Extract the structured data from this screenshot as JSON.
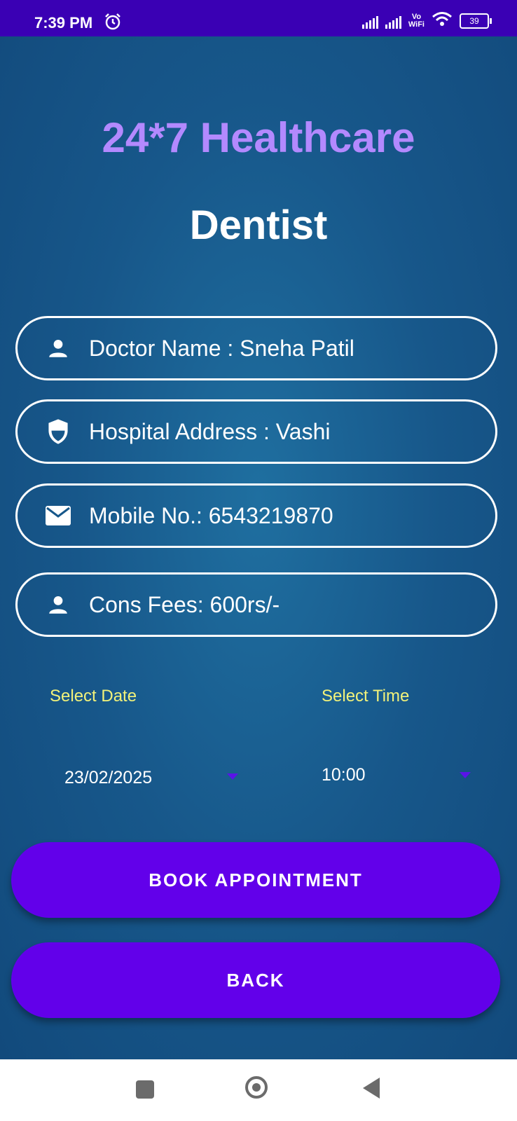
{
  "status_bar": {
    "time": "7:39 PM",
    "vowifi_top": "Vo",
    "vowifi_bottom": "WiFi",
    "battery": "39"
  },
  "header": {
    "app_title": "24*7 Healthcare",
    "page_title": "Dentist"
  },
  "fields": [
    {
      "icon": "person-icon",
      "text": "Doctor Name : Sneha Patil"
    },
    {
      "icon": "shield-icon",
      "text": "Hospital Address : Vashi"
    },
    {
      "icon": "mail-icon",
      "text": "Mobile No.: 6543219870"
    },
    {
      "icon": "person-icon",
      "text": "Cons Fees: 600rs/-"
    }
  ],
  "date_picker": {
    "label": "Select Date",
    "value": "23/02/2025"
  },
  "time_picker": {
    "label": "Select Time",
    "value": "10:00"
  },
  "buttons": {
    "book": "BOOK APPOINTMENT",
    "back": "BACK"
  },
  "colors": {
    "status_bar": "#3a00b4",
    "app_title": "#b389ff",
    "button": "#6200ea",
    "label": "#f2f27a"
  }
}
